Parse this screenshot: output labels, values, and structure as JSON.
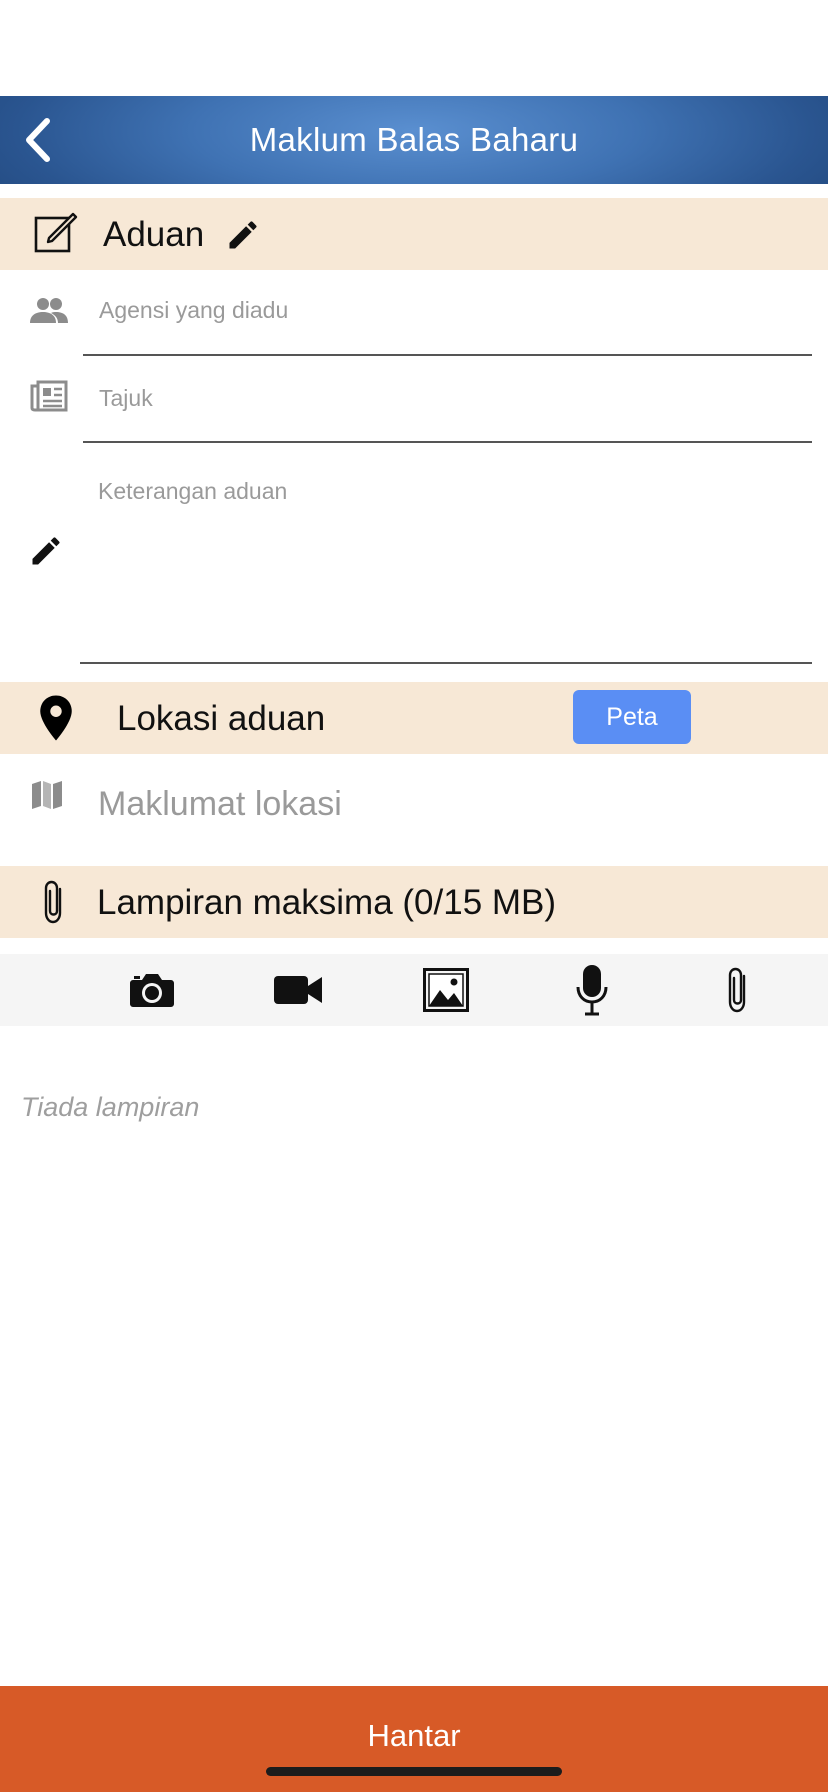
{
  "header": {
    "title": "Maklum Balas Baharu",
    "back_icon": "chevron-left-icon"
  },
  "complaint_section": {
    "label": "Aduan",
    "icons": [
      "edit-square-icon",
      "pencil-icon"
    ],
    "fields": {
      "agency_placeholder": "Agensi yang diadu",
      "title_placeholder": "Tajuk",
      "description_placeholder": "Keterangan aduan"
    }
  },
  "location_section": {
    "label": "Lokasi aduan",
    "map_button": "Peta",
    "location_placeholder": "Maklumat lokasi",
    "icons": [
      "location-pin-icon",
      "map-icon"
    ]
  },
  "attachment_section": {
    "label": "Lampiran maksima (0/15 MB)",
    "media_buttons": [
      "camera-icon",
      "video-icon",
      "image-icon",
      "microphone-icon",
      "paperclip-icon"
    ],
    "empty_text": "Tiada lampiran"
  },
  "footer": {
    "submit_label": "Hantar"
  },
  "colors": {
    "header_blue": "#3f72b3",
    "section_bg": "#f7e8d6",
    "button_blue": "#5a8ef4",
    "submit_orange": "#d75a27"
  }
}
